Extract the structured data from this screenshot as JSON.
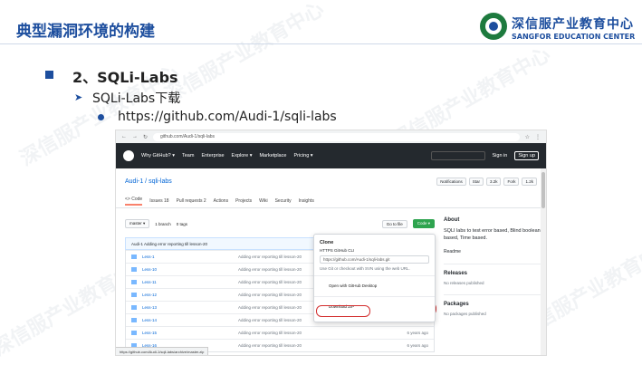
{
  "slide": {
    "title": "典型漏洞环境的构建",
    "logo_cn": "深信服产业教育中心",
    "logo_en": "SANGFOR EDUCATION CENTER",
    "watermark_cn": "深信服产业教育中心",
    "watermark_en": "SANGFOR EDUCATION CENTER"
  },
  "outline": {
    "heading": "2、SQLi-Labs",
    "sub": "SQLi-Labs下载",
    "link": "https://github.com/Audi-1/sqli-labs"
  },
  "browser": {
    "url": "github.com/Audi-1/sqli-labs",
    "status_url": "https://github.com/Audi-1/sqli-labs/archive/master.zip",
    "header": {
      "why": "Why GitHub? ▾",
      "team": "Team",
      "enterprise": "Enterprise",
      "explore": "Explore ▾",
      "marketplace": "Marketplace",
      "pricing": "Pricing ▾",
      "signin": "Sign in",
      "signup": "Sign up"
    },
    "repo": {
      "name": "Audi-1 / sqli-labs",
      "notifications": "Notifications",
      "star": "Star",
      "star_count": "3.2k",
      "fork": "Fork",
      "fork_count": "1.2k"
    },
    "tabs": [
      "<> Code",
      "Issues 18",
      "Pull requests 2",
      "Actions",
      "Projects",
      "Wiki",
      "Security",
      "Insights"
    ],
    "branch": "master ▾",
    "branches": "1 branch",
    "tags": "0 tags",
    "goto": "Go to file",
    "code": "Code ▾",
    "commit": "Audi-1 Adding error reporting till lesson-20",
    "files": [
      {
        "name": "Less-1",
        "msg": "Adding error reporting till lesson-20",
        "age": ""
      },
      {
        "name": "Less-10",
        "msg": "Adding error reporting till lesson-20",
        "age": ""
      },
      {
        "name": "Less-11",
        "msg": "Adding error reporting till lesson-20",
        "age": ""
      },
      {
        "name": "Less-12",
        "msg": "Adding error reporting till lesson-20",
        "age": ""
      },
      {
        "name": "Less-13",
        "msg": "Adding error reporting till lesson-20",
        "age": "6 years ago"
      },
      {
        "name": "Less-14",
        "msg": "Adding error reporting till lesson-20",
        "age": "6 years ago"
      },
      {
        "name": "Less-15",
        "msg": "Adding error reporting till lesson-20",
        "age": "6 years ago"
      },
      {
        "name": "Less-16",
        "msg": "Adding error reporting till lesson-20",
        "age": "6 years ago"
      }
    ],
    "popup": {
      "clone": "Clone",
      "https": "HTTPS   GitHub CLI",
      "url": "https://github.com/Audi-1/sqli-labs.git",
      "hint": "Use Git or checkout with SVN using the web URL.",
      "desktop": "Open with GitHub Desktop",
      "zip": "Download ZIP"
    },
    "sidebar": {
      "about": "About",
      "desc": "SQLI labs to test error based, Blind boolean based, Time based.",
      "readme": "Readme",
      "releases": "Releases",
      "no_releases": "No releases published",
      "packages": "Packages",
      "no_packages": "No packages published"
    }
  }
}
